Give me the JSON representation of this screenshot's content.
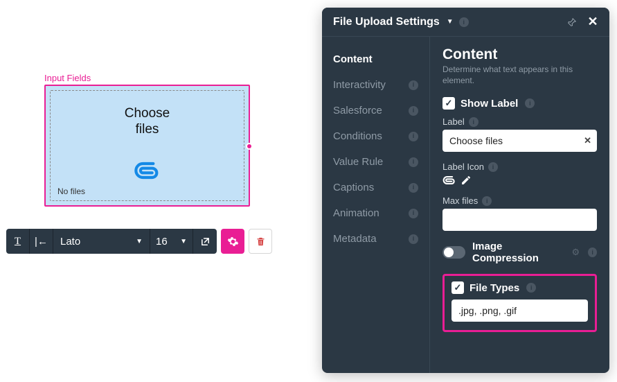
{
  "canvas": {
    "section_label": "Input Fields",
    "upload_text": "Choose\nfiles",
    "no_files": "No files"
  },
  "toolbar": {
    "font": "Lato",
    "size": "16"
  },
  "panel": {
    "title": "File Upload Settings",
    "nav": [
      {
        "label": "Content",
        "active": true
      },
      {
        "label": "Interactivity",
        "active": false
      },
      {
        "label": "Salesforce",
        "active": false
      },
      {
        "label": "Conditions",
        "active": false
      },
      {
        "label": "Value Rule",
        "active": false
      },
      {
        "label": "Captions",
        "active": false
      },
      {
        "label": "Animation",
        "active": false
      },
      {
        "label": "Metadata",
        "active": false
      }
    ],
    "content": {
      "heading": "Content",
      "subheading": "Determine what text appears in this element.",
      "show_label_label": "Show Label",
      "show_label_checked": true,
      "label_field_label": "Label",
      "label_value": "Choose files",
      "label_icon_label": "Label Icon",
      "max_files_label": "Max files",
      "max_files_value": "",
      "image_compression_label": "Image Compression",
      "image_compression_on": false,
      "file_types_label": "File Types",
      "file_types_checked": true,
      "file_types_value": ".jpg, .png, .gif"
    }
  }
}
